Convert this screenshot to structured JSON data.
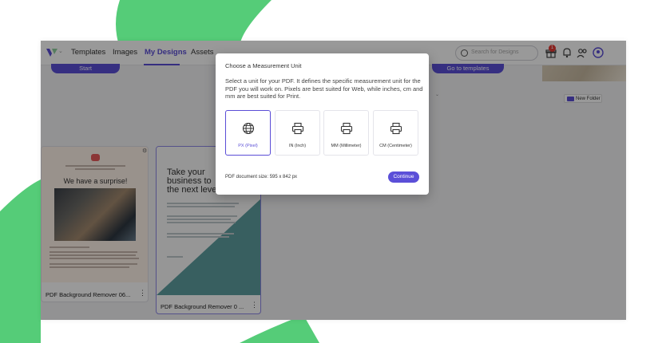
{
  "nav": {
    "links": [
      "Templates",
      "Images",
      "My Designs",
      "Assets"
    ],
    "active": "My Designs",
    "search_placeholder": "Search for Designs",
    "notification_count": "1"
  },
  "banner": {
    "start_label": "Start",
    "templates_label": "Go to templates"
  },
  "toolbar": {
    "new_folder_label": "New Folder"
  },
  "designs": [
    {
      "title": "PDF Background Remover 06...",
      "thumb_heading": "We have a surprise!"
    },
    {
      "title": "PDF Background Remover 0 ...",
      "thumb_heading_lines": [
        "Take your",
        "business to",
        "the next level"
      ]
    }
  ],
  "modal": {
    "title": "Choose a Measurement Unit",
    "description": "Select a unit for your PDF. It defines the specific measurement unit for the PDF you will work on. Pixels are best suited for Web, while inches, cm and mm are best suited for Print.",
    "units": [
      {
        "label": "PX (Pixel)",
        "icon": "globe-icon",
        "selected": true
      },
      {
        "label": "IN (Inch)",
        "icon": "printer-icon",
        "selected": false
      },
      {
        "label": "MM (Millimeter)",
        "icon": "printer-icon",
        "selected": false
      },
      {
        "label": "CM (Centimeter)",
        "icon": "printer-icon",
        "selected": false
      }
    ],
    "size_text": "PDF document size: 595 x 842 px",
    "continue_label": "Continue"
  },
  "colors": {
    "accent": "#5b4fd8",
    "backdrop_green": "#55cc78",
    "overlay": "rgba(0,0,0,0.40)"
  }
}
